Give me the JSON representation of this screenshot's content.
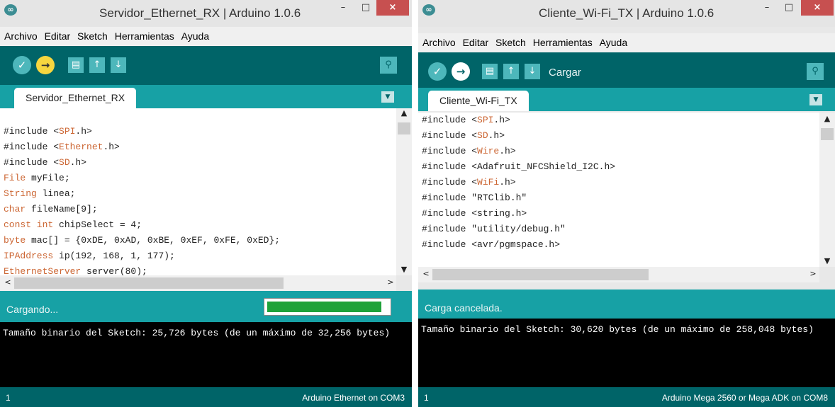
{
  "windows": [
    {
      "title": "Servidor_Ethernet_RX | Arduino 1.0.6",
      "menu": [
        "Archivo",
        "Editar",
        "Sketch",
        "Herramientas",
        "Ayuda"
      ],
      "toolbar": {
        "hover_label": ""
      },
      "tab": "Servidor_Ethernet_RX",
      "code": [
        {
          "pre": "",
          "lib": "",
          "post": ""
        },
        {
          "pre": "#include <",
          "lib": "SPI",
          "post": ".h>"
        },
        {
          "pre": "#include <",
          "lib": "Ethernet",
          "post": ".h>"
        },
        {
          "pre": "#include <",
          "lib": "SD",
          "post": ".h>"
        },
        {
          "pre": "",
          "lib": "File",
          "post": " myFile;"
        },
        {
          "pre": "",
          "lib": "String",
          "post": " linea;"
        },
        {
          "pre": "",
          "lib": "char",
          "post": " fileName[9];"
        },
        {
          "pre": "",
          "lib": "const int",
          "post": " chipSelect = 4;"
        },
        {
          "pre": "",
          "lib": "byte",
          "post": " mac[] = {0xDE, 0xAD, 0xBE, 0xEF, 0xFE, 0xED};"
        },
        {
          "pre": "",
          "lib": "IPAddress",
          "post": " ip(192, 168, 1, 177);"
        },
        {
          "pre": "",
          "lib": "EthernetServer",
          "post": " server(80);"
        }
      ],
      "status": "Cargando...",
      "progress": 0.95,
      "console": "Tamaño binario del Sketch: 25,726 bytes (de un máximo de 32,256 bytes)",
      "footer_line": "1",
      "footer_board": "Arduino Ethernet on COM3"
    },
    {
      "title": "Cliente_Wi-Fi_TX | Arduino 1.0.6",
      "menu": [
        "Archivo",
        "Editar",
        "Sketch",
        "Herramientas",
        "Ayuda"
      ],
      "toolbar": {
        "hover_label": "Cargar"
      },
      "tab": "Cliente_Wi-Fi_TX",
      "code": [
        {
          "pre": "#include <",
          "lib": "SPI",
          "post": ".h>"
        },
        {
          "pre": "#include <",
          "lib": "SD",
          "post": ".h>"
        },
        {
          "pre": "#include <",
          "lib": "Wire",
          "post": ".h>"
        },
        {
          "pre": "#include <Adafruit_NFCShield_I2C.h>",
          "lib": "",
          "post": ""
        },
        {
          "pre": "#include <",
          "lib": "WiFi",
          "post": ".h>"
        },
        {
          "pre": "#include \"RTClib.h\"",
          "lib": "",
          "post": ""
        },
        {
          "pre": "#include <string.h>",
          "lib": "",
          "post": ""
        },
        {
          "pre": "#include \"utility/debug.h\"",
          "lib": "",
          "post": ""
        },
        {
          "pre": "#include <avr/pgmspace.h>",
          "lib": "",
          "post": ""
        }
      ],
      "status": "Carga cancelada.",
      "console": "Tamaño binario del Sketch: 30,620 bytes (de un máximo de 258,048 bytes)",
      "footer_line": "1",
      "footer_board": "Arduino Mega 2560 or Mega ADK on COM8"
    }
  ],
  "icons": {
    "app": "∞",
    "verify": "✓",
    "upload": "→",
    "new": "▤",
    "open": "↑",
    "save": "↓",
    "serial": "⚲",
    "tab_menu": "▼",
    "min": "–",
    "max": "□",
    "close": "×",
    "up": "▲",
    "down": "▼",
    "left": "<",
    "right": ">"
  },
  "colors": {
    "toolbar": "#006468",
    "tabbar": "#17a1a5",
    "upload_active": "#f7d63f",
    "progress": "#1fa23a",
    "close": "#c75050"
  }
}
